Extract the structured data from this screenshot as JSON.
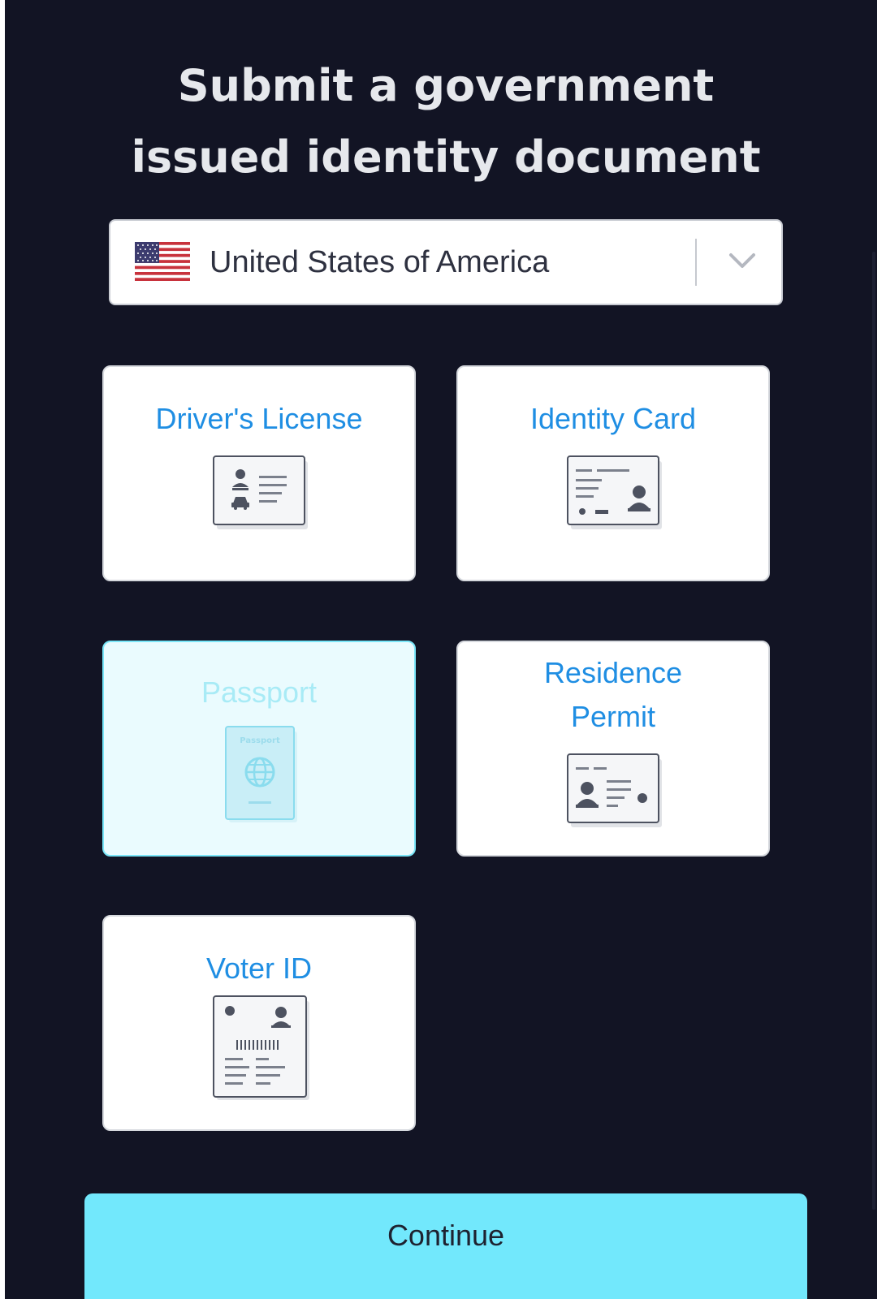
{
  "header": {
    "title_line1": "Submit a government",
    "title_line2": "issued identity document"
  },
  "country_select": {
    "selected": "United States of America",
    "flag_icon": "us-flag-icon",
    "chevron_icon": "chevron-down-icon"
  },
  "documents": [
    {
      "label": "Driver's License",
      "icon": "drivers-license-icon",
      "selected": false
    },
    {
      "label": "Identity Card",
      "icon": "identity-card-icon",
      "selected": false
    },
    {
      "label": "Passport",
      "icon": "passport-icon",
      "selected": true,
      "icon_text": "Passport"
    },
    {
      "label_line1": "Residence",
      "label_line2": "Permit",
      "icon": "residence-permit-icon",
      "selected": false
    },
    {
      "label": "Voter ID",
      "icon": "voter-id-icon",
      "selected": false
    }
  ],
  "actions": {
    "continue_label": "Continue"
  },
  "colors": {
    "background": "#121424",
    "accent": "#72e8fc",
    "label": "#1f8ee3",
    "selected_bg": "#eafbfe"
  }
}
